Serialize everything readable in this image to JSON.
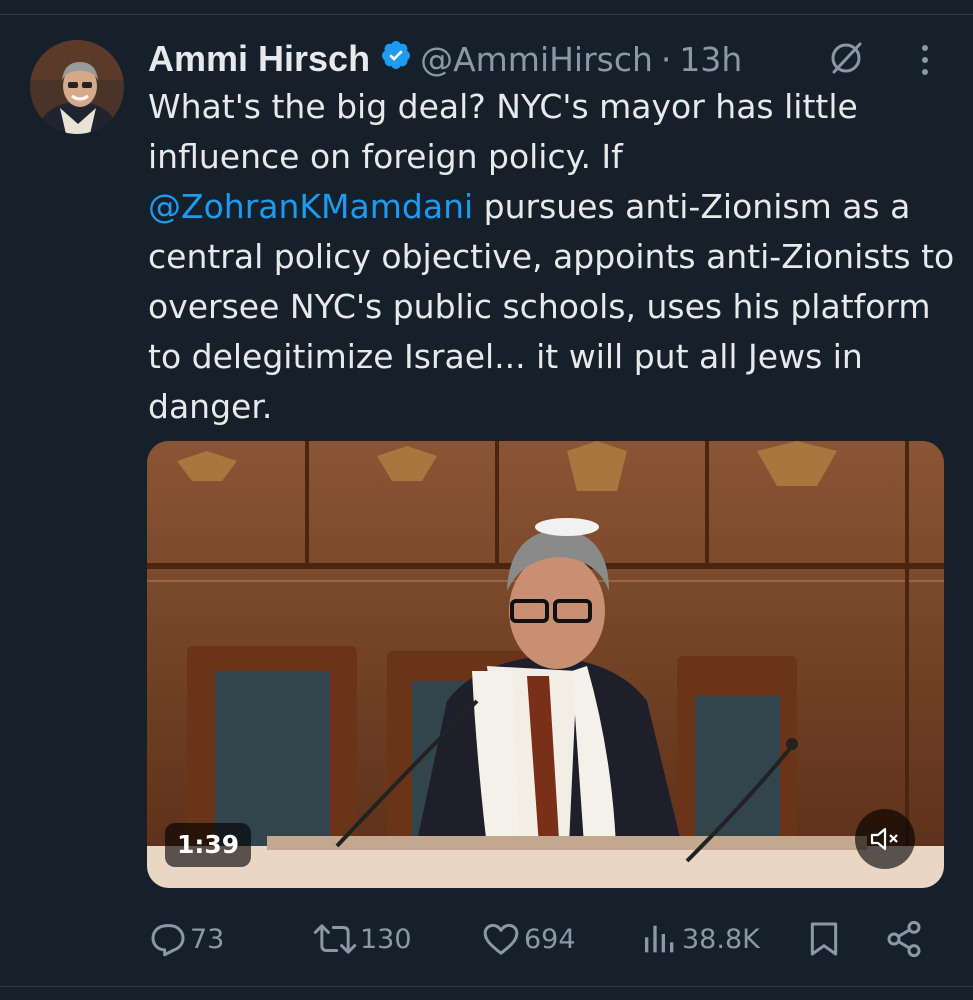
{
  "tweet": {
    "author_name": "Ammi Hirsch",
    "handle": "@AmmiHirsch",
    "separator": "·",
    "time": "13h",
    "text_part1": "What's the big deal? NYC's mayor has little influence on foreign policy. If ",
    "mention": "@ZohranKMamdani",
    "text_part2": " pursues anti-Zionism as a central policy objective, appoints anti-Zionists to oversee NYC's public schools, uses his platform to delegitimize Israel... it will put all Jews in danger."
  },
  "media": {
    "duration": "1:39",
    "muted": true
  },
  "actions": {
    "replies": "73",
    "reposts": "130",
    "likes": "694",
    "views": "38.8K"
  },
  "colors": {
    "background": "#15202b",
    "text": "#e7e9ea",
    "secondary": "#8b98a5",
    "accent": "#1d9bf0"
  },
  "icons": [
    "verified-badge-icon",
    "grok-icon",
    "more-icon",
    "mute-icon",
    "reply-icon",
    "repost-icon",
    "like-icon",
    "views-icon",
    "bookmark-icon",
    "share-icon"
  ]
}
